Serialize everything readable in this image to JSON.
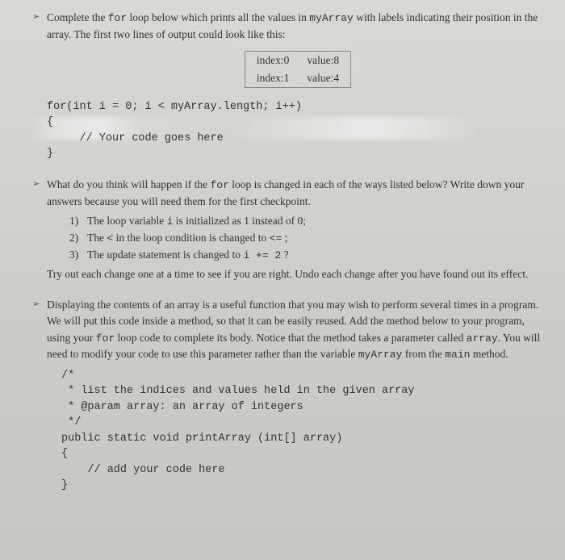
{
  "sections": {
    "s1": {
      "intro_a": "Complete the ",
      "intro_b": " loop below which prints all the values in ",
      "intro_c": " with labels indicating their position in the array. The first two lines of output could look like this:",
      "kw_for": "for",
      "kw_myArray": "myArray",
      "example": {
        "r1c1": "index:0",
        "r1c2": "value:8",
        "r2c1": "index:1",
        "r2c2": "value:4"
      },
      "code": "for(int i = 0; i < myArray.length; i++)\n{\n     // Your code goes here\n}"
    },
    "s2": {
      "intro_a": "What do you think will happen if the ",
      "intro_b": " loop is changed in each of the ways listed below? Write down your answers because you will need them for the first checkpoint.",
      "kw_for": "for",
      "items": {
        "n1": "1)",
        "t1a": "The loop variable ",
        "t1b": " is initialized as 1 instead of 0;",
        "kw_i": "i",
        "n2": "2)",
        "t2a": "The ",
        "t2b": "  in the loop condition is changed to ",
        "t2c": " ;",
        "kw_lt": "<",
        "kw_lte": "<=",
        "n3": "3)",
        "t3a": "The update statement is changed to ",
        "t3b": " ?",
        "kw_inc": "i  +=  2"
      },
      "outro": "Try out each change one at a time to see if you are right. Undo each change after you have found out its effect."
    },
    "s3": {
      "intro_a": "Displaying the contents of an array is a useful function that you may wish to perform several times in a program. We will put this code inside a method, so that it can be easily reused. Add the method below to your program, using your ",
      "intro_b": " loop code to complete its body. Notice that the method takes a parameter called ",
      "intro_c": ". You will need to modify your code to use this parameter rather than the variable ",
      "intro_d": " from the ",
      "intro_e": " method.",
      "kw_for": "for",
      "kw_array": "array",
      "kw_myArray": "myArray",
      "kw_main": "main",
      "code": "/*\n * list the indices and values held in the given array\n * @param array: an array of integers\n */\npublic static void printArray (int[] array)\n{\n    // add your code here\n}"
    }
  }
}
